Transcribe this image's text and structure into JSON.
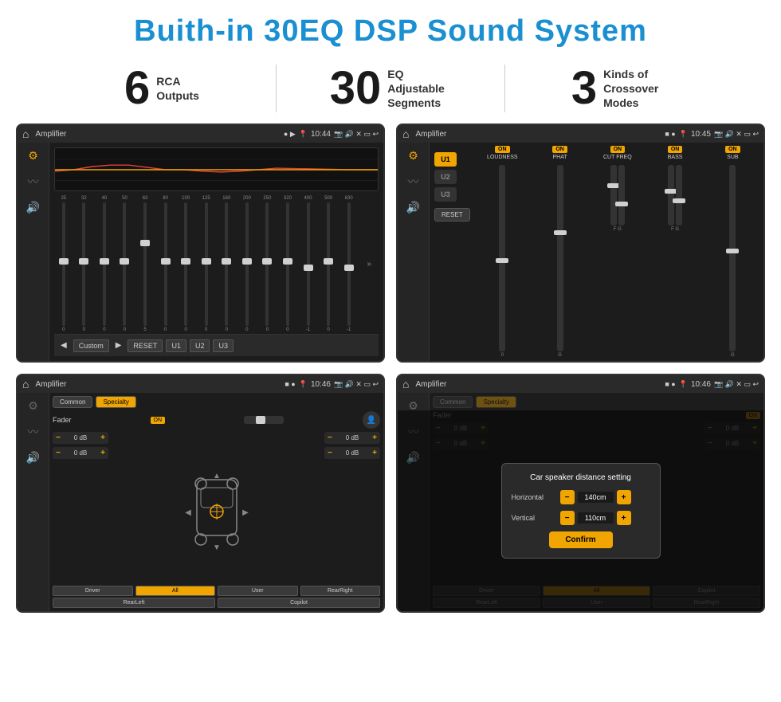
{
  "page": {
    "title": "Buith-in 30EQ DSP Sound System",
    "stats": [
      {
        "number": "6",
        "text": "RCA\nOutputs"
      },
      {
        "number": "30",
        "text": "EQ Adjustable\nSegments"
      },
      {
        "number": "3",
        "text": "Kinds of\nCrossover Modes"
      }
    ],
    "screens": [
      {
        "id": "eq-screen",
        "label": "Amplifier",
        "time": "10:44",
        "type": "eq"
      },
      {
        "id": "crossover-screen",
        "label": "Amplifier",
        "time": "10:45",
        "type": "crossover"
      },
      {
        "id": "fader-screen",
        "label": "Amplifier",
        "time": "10:46",
        "type": "fader"
      },
      {
        "id": "dialog-screen",
        "label": "Amplifier",
        "time": "10:46",
        "type": "dialog"
      }
    ],
    "eq": {
      "freqs": [
        "25",
        "32",
        "40",
        "50",
        "63",
        "80",
        "100",
        "125",
        "160",
        "200",
        "250",
        "320",
        "400",
        "500",
        "630"
      ],
      "values": [
        "0",
        "0",
        "0",
        "0",
        "5",
        "0",
        "0",
        "0",
        "0",
        "0",
        "0",
        "0",
        "-1",
        "0",
        "-1"
      ],
      "buttons": [
        "Custom",
        "RESET",
        "U1",
        "U2",
        "U3"
      ]
    },
    "crossover": {
      "u_buttons": [
        "U1",
        "U2",
        "U3"
      ],
      "controls": [
        {
          "label": "LOUDNESS",
          "on": true
        },
        {
          "label": "PHAT",
          "on": true
        },
        {
          "label": "CUT FREQ",
          "on": true
        },
        {
          "label": "BASS",
          "on": true
        },
        {
          "label": "SUB",
          "on": true
        }
      ]
    },
    "fader": {
      "tabs": [
        "Common",
        "Specialty"
      ],
      "fader_label": "Fader",
      "on": "ON",
      "left_controls": [
        "0 dB",
        "0 dB"
      ],
      "right_controls": [
        "0 dB",
        "0 dB"
      ],
      "footer_buttons": [
        "Driver",
        "",
        "",
        "User",
        "RearRight"
      ],
      "all_btn": "All",
      "rear_left": "RearLeft",
      "copilot": "Copilot"
    },
    "dialog": {
      "title": "Car speaker distance setting",
      "horizontal_label": "Horizontal",
      "horizontal_value": "140cm",
      "vertical_label": "Vertical",
      "vertical_value": "110cm",
      "confirm_label": "Confirm",
      "right_controls": [
        "0 dB",
        "0 dB"
      ]
    }
  }
}
